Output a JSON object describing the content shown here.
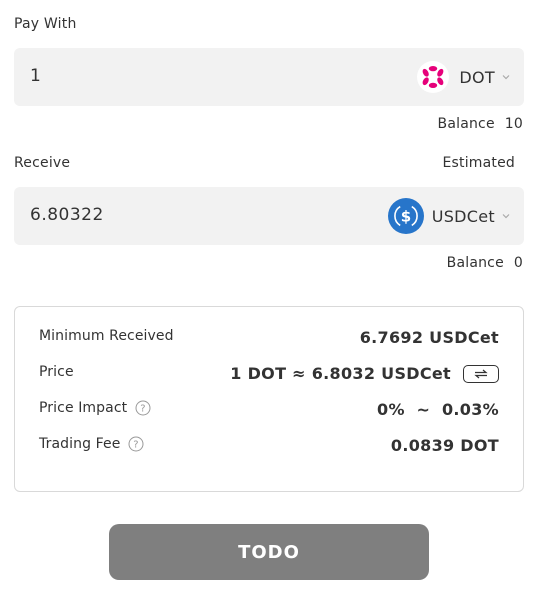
{
  "pay": {
    "label": "Pay With",
    "amount": "1",
    "token": "DOT",
    "token_icon": "polkadot-logo-icon",
    "balance_label": "Balance",
    "balance_value": "10"
  },
  "receive": {
    "label": "Receive",
    "estimated_label": "Estimated",
    "amount": "6.80322",
    "token": "USDCet",
    "token_icon": "usdc-logo-icon",
    "balance_label": "Balance",
    "balance_value": "0"
  },
  "details": {
    "minimum_received_label": "Minimum Received",
    "minimum_received_value": "6.7692 USDCet",
    "price_label": "Price",
    "price_value": "1 DOT ≈ 6.8032 USDCet",
    "price_impact_label": "Price Impact",
    "price_impact_value": "0%  ~  0.03%",
    "trading_fee_label": "Trading Fee",
    "trading_fee_value": "0.0839 DOT"
  },
  "action_button": {
    "label": "TODO"
  },
  "colors": {
    "dot_pink": "#e6007a",
    "usdc_blue": "#2775ca",
    "input_bg": "#f2f2f2",
    "button_bg": "#7f7f7f"
  }
}
